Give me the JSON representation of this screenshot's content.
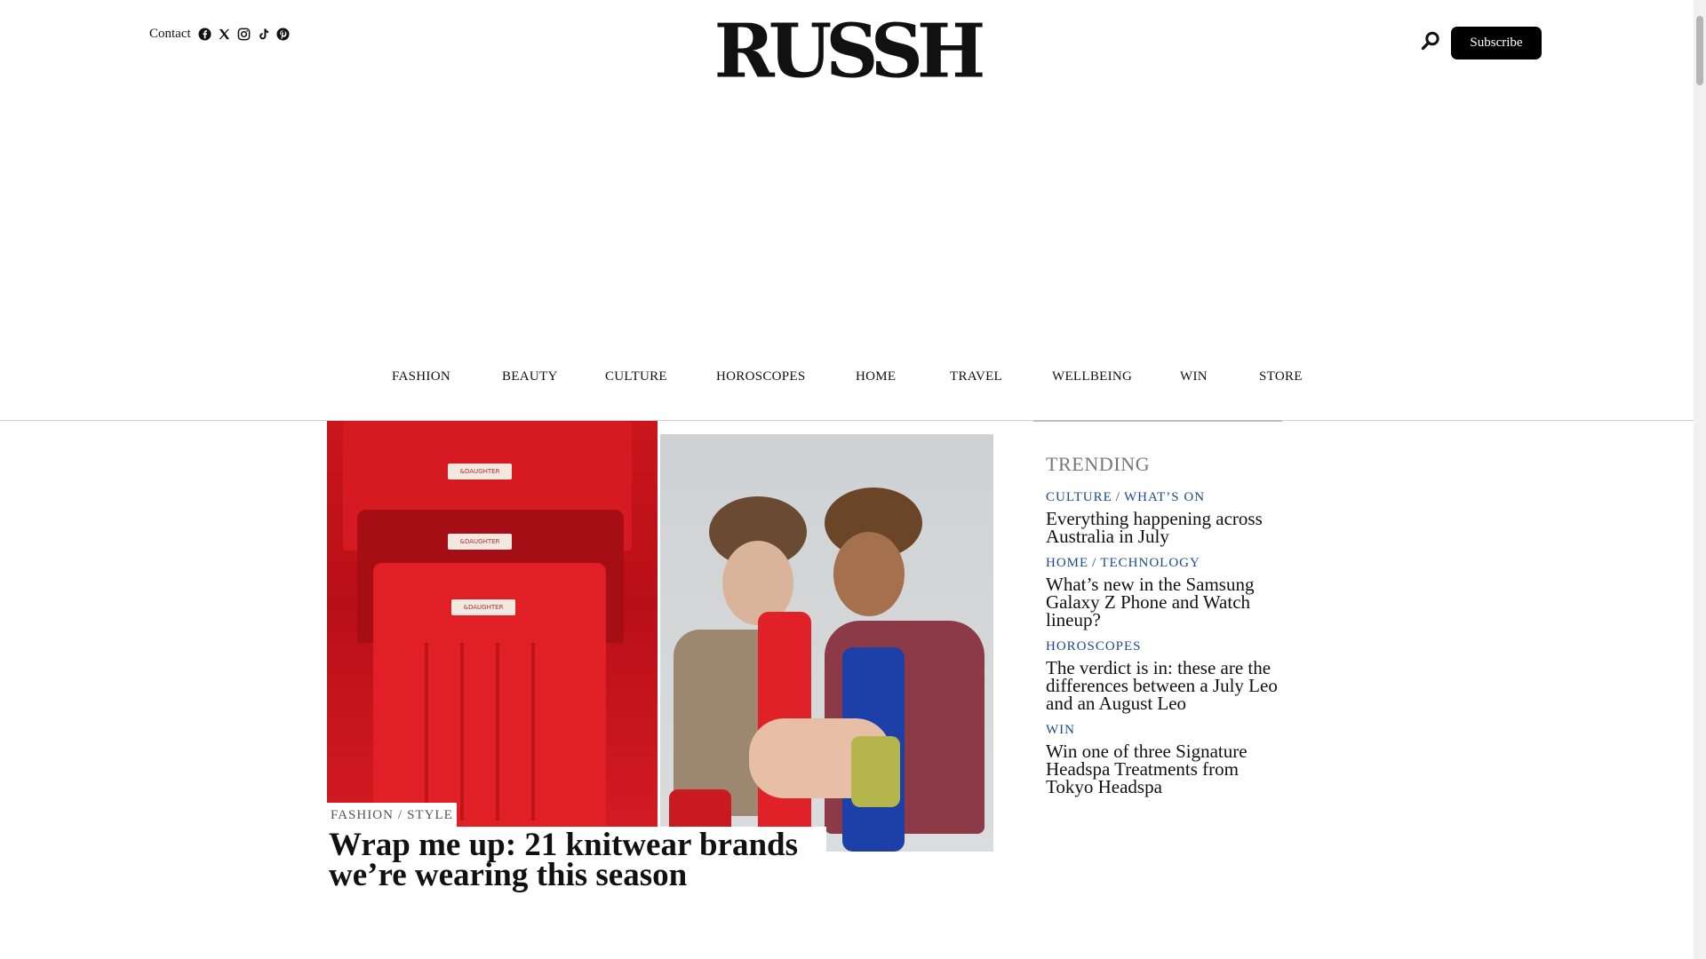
{
  "header": {
    "contact_label": "Contact",
    "social_icons": [
      "facebook-icon",
      "x-icon",
      "instagram-icon",
      "tiktok-icon",
      "pinterest-icon"
    ],
    "logo_text": "RUSSH",
    "subscribe_label": "Subscribe"
  },
  "nav": {
    "items": [
      "FASHION",
      "BEAUTY",
      "CULTURE",
      "HOROSCOPES",
      "HOME",
      "TRAVEL",
      "WELLBEING",
      "WIN",
      "STORE"
    ]
  },
  "feature": {
    "category_primary": "FASHION",
    "category_separator": "/",
    "category_secondary": "STYLE",
    "title": "Wrap me up: 21 knitwear brands we’re wearing this season",
    "tag_text": "&DAUGHTER"
  },
  "trending": {
    "heading": "TRENDING",
    "items": [
      {
        "cats": [
          "CULTURE",
          "WHAT’S ON"
        ],
        "title": "Everything happening across Australia in July"
      },
      {
        "cats": [
          "HOME",
          "TECHNOLOGY"
        ],
        "title": "What’s new in the Samsung Galaxy Z Phone and Watch lineup?"
      },
      {
        "cats": [
          "HOROSCOPES"
        ],
        "title": "The verdict is in: these are the differences between a July Leo and an August Leo"
      },
      {
        "cats": [
          "WIN"
        ],
        "title": "Win one of three Signature Headspa Treatments from Tokyo Headspa"
      }
    ]
  },
  "colors": {
    "accent_link": "#1a4a8a",
    "subscribe_bg": "#000000"
  }
}
